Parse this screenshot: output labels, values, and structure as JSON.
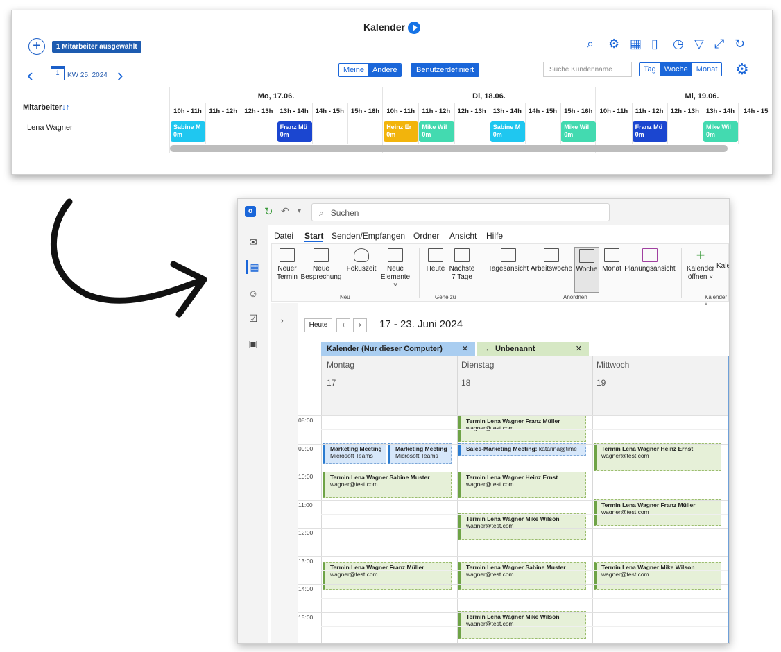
{
  "top": {
    "title": "Kalender",
    "selected_badge": "1 Mitarbeiter ausgewählt",
    "week_label": "KW 25, 2024",
    "mini_cal_num": "1",
    "filter_meine": "Meine",
    "filter_andere": "Andere",
    "custom_btn": "Benutzerdefiniert",
    "search_placeholder": "Suche Kundenname",
    "view_tag": "Tag",
    "view_woche": "Woche",
    "view_monat": "Monat",
    "employee_header": "Mitarbeiter",
    "employee_name": "Lena Wagner",
    "days": [
      "Mo, 17.06.",
      "Di, 18.06.",
      "Mi, 19.06."
    ],
    "hours": [
      "10h - 11h",
      "11h - 12h",
      "12h - 13h",
      "13h - 14h",
      "14h - 15h",
      "15h - 16h",
      "10h - 11h",
      "11h - 12h",
      "12h - 13h",
      "13h - 14h",
      "14h - 15h",
      "15h - 16h",
      "10h - 11h",
      "11h - 12h",
      "12h - 13h",
      "13h - 14h",
      "14h - 15"
    ],
    "events": [
      {
        "name": "Sabine M",
        "dur": "0m",
        "color": "#1fc7f0"
      },
      {
        "name": "Franz Mü",
        "dur": "0m",
        "color": "#1b46d0"
      },
      {
        "name": "Heinz Er",
        "dur": "0m",
        "color": "#f2b40c"
      },
      {
        "name": "Mike Wil",
        "dur": "0m",
        "color": "#43dab0"
      },
      {
        "name": "Sabine M",
        "dur": "0m",
        "color": "#1fc7f0"
      },
      {
        "name": "Mike Wil",
        "dur": "0m",
        "color": "#43dab0"
      },
      {
        "name": "Franz Mü",
        "dur": "0m",
        "color": "#1b46d0"
      },
      {
        "name": "Mike Wil",
        "dur": "0m",
        "color": "#43dab0"
      }
    ]
  },
  "outlook": {
    "search": "Suchen",
    "menu": [
      "Datei",
      "Start",
      "Senden/Empfangen",
      "Ordner",
      "Ansicht",
      "Hilfe"
    ],
    "ribbon": {
      "neuer_termin": "Neuer Termin",
      "neue_besprechung": "Neue Besprechung",
      "fokuszeit": "Fokuszeit",
      "neue_elemente": "Neue Elemente ˅",
      "heute": "Heute",
      "naechste": "Nächste 7 Tage",
      "tagesansicht": "Tagesansicht",
      "arbeitswoche": "Arbeitswoche",
      "woche": "Woche",
      "monat": "Monat",
      "planungsansicht": "Planungsansicht",
      "kalender_oeffnen": "Kalender öffnen ˅",
      "kale": "Kale",
      "grp_neu": "Neu",
      "grp_gehe": "Gehe zu",
      "grp_anordnen": "Anordnen",
      "grp_kalender": "Kalender v"
    },
    "heute_btn": "Heute",
    "date_range": "17 - 23. Juni 2024",
    "cal_tab1": "Kalender (Nur dieser Computer)",
    "cal_tab2": "Unbenannt",
    "columns": [
      {
        "day": "Montag",
        "num": "17"
      },
      {
        "day": "Dienstag",
        "num": "18"
      },
      {
        "day": "Mittwoch",
        "num": "19"
      }
    ],
    "times": [
      "08:00",
      "09:00",
      "10:00",
      "11:00",
      "12:00",
      "13:00",
      "14:00",
      "15:00"
    ],
    "events": {
      "e1_t": "Termin Lena Wagner Franz Müller",
      "e1_s": "wagner@test.com",
      "e2_t": "Marketing Meeting",
      "e2_s": "Microsoft Teams",
      "e3_t": "Marketing Meeting",
      "e3_s": "Microsoft Teams",
      "e4_t": "Sales-Marketing Meeting:",
      "e4_s": "katarina@time",
      "e5_t": "Termin Lena Wagner Heinz Ernst",
      "e5_s": "wagner@test.com",
      "e6_t": "Termin Lena Wagner Sabine Muster",
      "e6_s": "wagner@test.com",
      "e7_t": "Termin Lena Wagner Heinz Ernst",
      "e7_s": "wagner@test.com",
      "e8_t": "Termin Lena Wagner Franz Müller",
      "e8_s": "wagner@test.com",
      "e9_t": "Termin Lena Wagner Mike Wilson",
      "e9_s": "wagner@test.com",
      "e10_t": "Termin Lena Wagner Franz Müller",
      "e10_s": "wagner@test.com",
      "e11_t": "Termin Lena Wagner Sabine Muster",
      "e11_s": "wagner@test.com",
      "e12_t": "Termin Lena Wagner Mike Wilson",
      "e12_s": "wagner@test.com",
      "e13_t": "Termin Lena Wagner Mike Wilson",
      "e13_s": "wagner@test.com"
    }
  }
}
